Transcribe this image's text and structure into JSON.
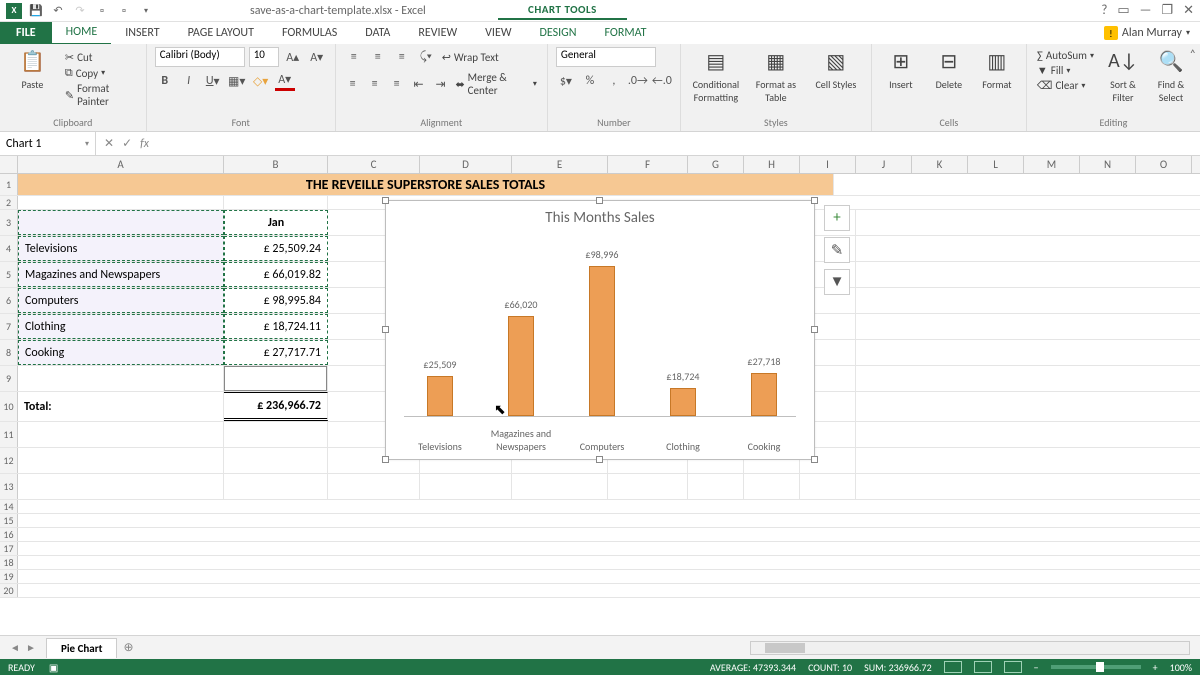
{
  "title": {
    "document": "save-as-a-chart-template.xlsx - Excel",
    "context_tool": "CHART TOOLS"
  },
  "user": {
    "name": "Alan Murray"
  },
  "tabs": {
    "file": "FILE",
    "home": "HOME",
    "insert": "INSERT",
    "page": "PAGE LAYOUT",
    "formulas": "FORMULAS",
    "data": "DATA",
    "review": "REVIEW",
    "view": "VIEW",
    "design": "DESIGN",
    "format": "FORMAT"
  },
  "ribbon": {
    "clipboard": {
      "label": "Clipboard",
      "paste": "Paste",
      "cut": "Cut",
      "copy": "Copy",
      "fp": "Format Painter"
    },
    "font": {
      "label": "Font",
      "family": "Calibri (Body)",
      "size": "10"
    },
    "alignment": {
      "label": "Alignment",
      "wrap": "Wrap Text",
      "merge": "Merge & Center"
    },
    "number": {
      "label": "Number",
      "format": "General"
    },
    "styles": {
      "label": "Styles",
      "cond": "Conditional Formatting",
      "fas": "Format as Table",
      "cs": "Cell Styles"
    },
    "cells": {
      "label": "Cells",
      "insert": "Insert",
      "delete": "Delete",
      "format": "Format"
    },
    "editing": {
      "label": "Editing",
      "autosum": "AutoSum",
      "fill": "Fill",
      "clear": "Clear",
      "sort": "Sort & Filter",
      "find": "Find & Select"
    }
  },
  "namebox": "Chart 1",
  "columns": [
    "A",
    "B",
    "C",
    "D",
    "E",
    "F",
    "G",
    "H",
    "I",
    "J",
    "K",
    "L",
    "M",
    "N",
    "O"
  ],
  "sheet": {
    "title": "THE REVEILLE SUPERSTORE SALES TOTALS",
    "jan": "Jan",
    "rows": [
      {
        "n": "4",
        "label": "Televisions",
        "value": "£     25,509.24"
      },
      {
        "n": "5",
        "label": "Magazines and Newspapers",
        "value": "£     66,019.82"
      },
      {
        "n": "6",
        "label": "Computers",
        "value": "£     98,995.84"
      },
      {
        "n": "7",
        "label": "Clothing",
        "value": "£     18,724.11"
      },
      {
        "n": "8",
        "label": "Cooking",
        "value": "£     27,717.71"
      }
    ],
    "total_label": "Total:",
    "total_value": "£   236,966.72"
  },
  "chart": {
    "title": "This Months Sales"
  },
  "chart_data": {
    "type": "bar",
    "title": "This Months Sales",
    "categories": [
      "Televisions",
      "Magazines and\nNewspapers",
      "Computers",
      "Clothing",
      "Cooking"
    ],
    "values": [
      25509,
      66020,
      98996,
      18724,
      27718
    ],
    "data_labels": [
      "£25,509",
      "£66,020",
      "£98,996",
      "£18,724",
      "£27,718"
    ],
    "ylim": [
      0,
      100000
    ],
    "xlabel": "",
    "ylabel": ""
  },
  "sheet_tab": "Pie Chart",
  "status": {
    "ready": "READY",
    "avg": "AVERAGE: 47393.344",
    "count": "COUNT: 10",
    "sum": "SUM: 236966.72",
    "zoom": "100%"
  }
}
